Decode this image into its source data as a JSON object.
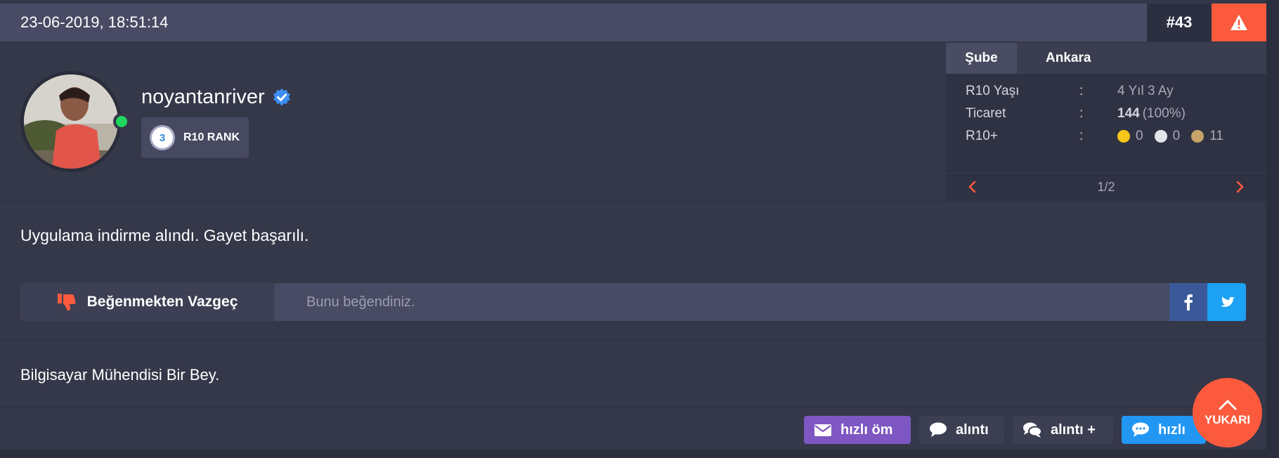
{
  "post": {
    "date": "23-06-2019, 18:51:14",
    "number": "#43"
  },
  "user": {
    "username": "noyantanriver",
    "rank_level": "3",
    "rank_label": "R10 RANK"
  },
  "info": {
    "tab_label": "Şube",
    "tab_value": "Ankara",
    "rows": [
      {
        "key": "R10 Yaşı",
        "colon": ":",
        "value": "4 Yıl 3 Ay"
      },
      {
        "key": "Ticaret",
        "colon": ":",
        "value_bold": "144",
        "value_rest": " (100%)"
      },
      {
        "key": "R10+",
        "colon": ":",
        "gold": "0",
        "silver": "0",
        "bronze": "11"
      }
    ],
    "pager": "1/2"
  },
  "message": "Uygulama indirme alındı. Gayet başarılı.",
  "like_bar": {
    "unlike_label": "Beğenmekten Vazgeç",
    "like_info": "Bunu beğendiniz."
  },
  "signature": "Bilgisayar Mühendisi Bir Bey.",
  "actions": {
    "pm": "hızlı öm",
    "quote": "alıntı",
    "multiquote": "alıntı +",
    "quickreply": "hızlı"
  },
  "scroll_top": "YUKARI",
  "colors": {
    "accent": "#fb5b3c",
    "online": "#1fd65f",
    "pm": "#7e57c2",
    "quickreply": "#2196f3",
    "facebook": "#3b5998",
    "twitter": "#1da1f2"
  }
}
